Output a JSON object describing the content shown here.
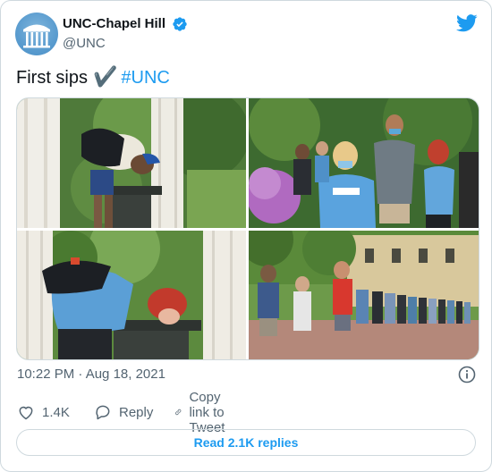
{
  "author": {
    "name": "UNC-Chapel Hill",
    "handle": "@UNC",
    "verified": true,
    "avatar_icon": "old-well-icon"
  },
  "brand_icon": "twitter-bird-icon",
  "tweet": {
    "text": "First sips",
    "check_glyph": "✔️",
    "hashtag": "#UNC"
  },
  "media": {
    "count": 4,
    "photos": [
      {
        "icon": "photo-student-drinking-fountain"
      },
      {
        "icon": "photo-students-in-line-masks"
      },
      {
        "icon": "photo-student-red-hair-drinking"
      },
      {
        "icon": "photo-long-line-of-students"
      }
    ]
  },
  "meta": {
    "timestamp": "10:22 PM · Aug 18, 2021"
  },
  "actions": {
    "like_count": "1.4K",
    "reply_label": "Reply",
    "copy_label": "Copy link to Tweet"
  },
  "read_replies_label": "Read 2.1K replies",
  "colors": {
    "accent": "#1d9bf0",
    "text": "#0f1419",
    "secondary": "#536471",
    "border": "#cfd9de"
  }
}
